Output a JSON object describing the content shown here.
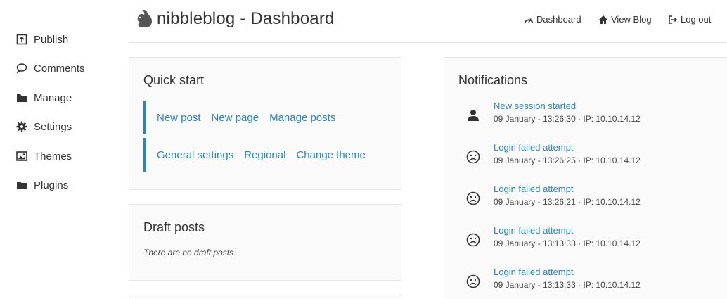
{
  "header": {
    "title": "nibbleblog - Dashboard",
    "nav": [
      {
        "label": "Dashboard",
        "icon": "speedometer-icon"
      },
      {
        "label": "View Blog",
        "icon": "home-icon"
      },
      {
        "label": "Log out",
        "icon": "logout-icon"
      }
    ]
  },
  "sidebar": {
    "items": [
      {
        "label": "Publish",
        "icon": "publish-icon"
      },
      {
        "label": "Comments",
        "icon": "comment-icon"
      },
      {
        "label": "Manage",
        "icon": "folder-icon"
      },
      {
        "label": "Settings",
        "icon": "gear-icon"
      },
      {
        "label": "Themes",
        "icon": "image-icon"
      },
      {
        "label": "Plugins",
        "icon": "folder-icon"
      }
    ]
  },
  "quick_start": {
    "title": "Quick start",
    "row1": [
      "New post",
      "New page",
      "Manage posts"
    ],
    "row2": [
      "General settings",
      "Regional",
      "Change theme"
    ]
  },
  "drafts": {
    "title": "Draft posts",
    "empty_text": "There are no draft posts."
  },
  "notifications": {
    "title": "Notifications",
    "items": [
      {
        "title": "New session started",
        "meta": "09 January - 13:26:30 · IP: 10.10.14.12",
        "icon": "user-icon"
      },
      {
        "title": "Login failed attempt",
        "meta": "09 January - 13:26:25 · IP: 10.10.14.12",
        "icon": "sad-face-icon"
      },
      {
        "title": "Login failed attempt",
        "meta": "09 January - 13:26:21 · IP: 10.10.14.12",
        "icon": "sad-face-icon"
      },
      {
        "title": "Login failed attempt",
        "meta": "09 January - 13:13:33 · IP: 10.10.14.12",
        "icon": "sad-face-icon"
      },
      {
        "title": "Login failed attempt",
        "meta": "09 January - 13:13:33 · IP: 10.10.14.12",
        "icon": "sad-face-icon"
      }
    ]
  },
  "colors": {
    "link": "#2a85c0",
    "accent_bar": "#2a85c0",
    "panel_bg": "#fafafa",
    "border": "#e5e5e5"
  }
}
